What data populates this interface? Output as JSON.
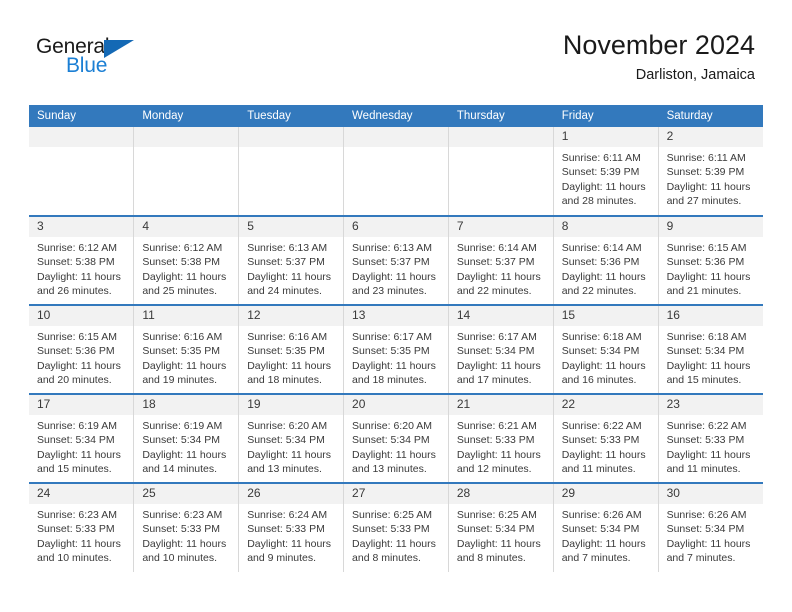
{
  "brand": {
    "name_part1": "General",
    "name_part2": "Blue",
    "accent_color": "#1b7fd4",
    "triangle_color": "#1469b5"
  },
  "header": {
    "title": "November 2024",
    "subtitle": "Darliston, Jamaica",
    "header_bar_color": "#3379bd"
  },
  "weekdays": [
    "Sunday",
    "Monday",
    "Tuesday",
    "Wednesday",
    "Thursday",
    "Friday",
    "Saturday"
  ],
  "weeks": [
    [
      {
        "day": "",
        "blank": true
      },
      {
        "day": "",
        "blank": true
      },
      {
        "day": "",
        "blank": true
      },
      {
        "day": "",
        "blank": true
      },
      {
        "day": "",
        "blank": true
      },
      {
        "day": "1",
        "sunrise": "Sunrise: 6:11 AM",
        "sunset": "Sunset: 5:39 PM",
        "daylight": "Daylight: 11 hours and 28 minutes."
      },
      {
        "day": "2",
        "sunrise": "Sunrise: 6:11 AM",
        "sunset": "Sunset: 5:39 PM",
        "daylight": "Daylight: 11 hours and 27 minutes."
      }
    ],
    [
      {
        "day": "3",
        "sunrise": "Sunrise: 6:12 AM",
        "sunset": "Sunset: 5:38 PM",
        "daylight": "Daylight: 11 hours and 26 minutes."
      },
      {
        "day": "4",
        "sunrise": "Sunrise: 6:12 AM",
        "sunset": "Sunset: 5:38 PM",
        "daylight": "Daylight: 11 hours and 25 minutes."
      },
      {
        "day": "5",
        "sunrise": "Sunrise: 6:13 AM",
        "sunset": "Sunset: 5:37 PM",
        "daylight": "Daylight: 11 hours and 24 minutes."
      },
      {
        "day": "6",
        "sunrise": "Sunrise: 6:13 AM",
        "sunset": "Sunset: 5:37 PM",
        "daylight": "Daylight: 11 hours and 23 minutes."
      },
      {
        "day": "7",
        "sunrise": "Sunrise: 6:14 AM",
        "sunset": "Sunset: 5:37 PM",
        "daylight": "Daylight: 11 hours and 22 minutes."
      },
      {
        "day": "8",
        "sunrise": "Sunrise: 6:14 AM",
        "sunset": "Sunset: 5:36 PM",
        "daylight": "Daylight: 11 hours and 22 minutes."
      },
      {
        "day": "9",
        "sunrise": "Sunrise: 6:15 AM",
        "sunset": "Sunset: 5:36 PM",
        "daylight": "Daylight: 11 hours and 21 minutes."
      }
    ],
    [
      {
        "day": "10",
        "sunrise": "Sunrise: 6:15 AM",
        "sunset": "Sunset: 5:36 PM",
        "daylight": "Daylight: 11 hours and 20 minutes."
      },
      {
        "day": "11",
        "sunrise": "Sunrise: 6:16 AM",
        "sunset": "Sunset: 5:35 PM",
        "daylight": "Daylight: 11 hours and 19 minutes."
      },
      {
        "day": "12",
        "sunrise": "Sunrise: 6:16 AM",
        "sunset": "Sunset: 5:35 PM",
        "daylight": "Daylight: 11 hours and 18 minutes."
      },
      {
        "day": "13",
        "sunrise": "Sunrise: 6:17 AM",
        "sunset": "Sunset: 5:35 PM",
        "daylight": "Daylight: 11 hours and 18 minutes."
      },
      {
        "day": "14",
        "sunrise": "Sunrise: 6:17 AM",
        "sunset": "Sunset: 5:34 PM",
        "daylight": "Daylight: 11 hours and 17 minutes."
      },
      {
        "day": "15",
        "sunrise": "Sunrise: 6:18 AM",
        "sunset": "Sunset: 5:34 PM",
        "daylight": "Daylight: 11 hours and 16 minutes."
      },
      {
        "day": "16",
        "sunrise": "Sunrise: 6:18 AM",
        "sunset": "Sunset: 5:34 PM",
        "daylight": "Daylight: 11 hours and 15 minutes."
      }
    ],
    [
      {
        "day": "17",
        "sunrise": "Sunrise: 6:19 AM",
        "sunset": "Sunset: 5:34 PM",
        "daylight": "Daylight: 11 hours and 15 minutes."
      },
      {
        "day": "18",
        "sunrise": "Sunrise: 6:19 AM",
        "sunset": "Sunset: 5:34 PM",
        "daylight": "Daylight: 11 hours and 14 minutes."
      },
      {
        "day": "19",
        "sunrise": "Sunrise: 6:20 AM",
        "sunset": "Sunset: 5:34 PM",
        "daylight": "Daylight: 11 hours and 13 minutes."
      },
      {
        "day": "20",
        "sunrise": "Sunrise: 6:20 AM",
        "sunset": "Sunset: 5:34 PM",
        "daylight": "Daylight: 11 hours and 13 minutes."
      },
      {
        "day": "21",
        "sunrise": "Sunrise: 6:21 AM",
        "sunset": "Sunset: 5:33 PM",
        "daylight": "Daylight: 11 hours and 12 minutes."
      },
      {
        "day": "22",
        "sunrise": "Sunrise: 6:22 AM",
        "sunset": "Sunset: 5:33 PM",
        "daylight": "Daylight: 11 hours and 11 minutes."
      },
      {
        "day": "23",
        "sunrise": "Sunrise: 6:22 AM",
        "sunset": "Sunset: 5:33 PM",
        "daylight": "Daylight: 11 hours and 11 minutes."
      }
    ],
    [
      {
        "day": "24",
        "sunrise": "Sunrise: 6:23 AM",
        "sunset": "Sunset: 5:33 PM",
        "daylight": "Daylight: 11 hours and 10 minutes."
      },
      {
        "day": "25",
        "sunrise": "Sunrise: 6:23 AM",
        "sunset": "Sunset: 5:33 PM",
        "daylight": "Daylight: 11 hours and 10 minutes."
      },
      {
        "day": "26",
        "sunrise": "Sunrise: 6:24 AM",
        "sunset": "Sunset: 5:33 PM",
        "daylight": "Daylight: 11 hours and 9 minutes."
      },
      {
        "day": "27",
        "sunrise": "Sunrise: 6:25 AM",
        "sunset": "Sunset: 5:33 PM",
        "daylight": "Daylight: 11 hours and 8 minutes."
      },
      {
        "day": "28",
        "sunrise": "Sunrise: 6:25 AM",
        "sunset": "Sunset: 5:34 PM",
        "daylight": "Daylight: 11 hours and 8 minutes."
      },
      {
        "day": "29",
        "sunrise": "Sunrise: 6:26 AM",
        "sunset": "Sunset: 5:34 PM",
        "daylight": "Daylight: 11 hours and 7 minutes."
      },
      {
        "day": "30",
        "sunrise": "Sunrise: 6:26 AM",
        "sunset": "Sunset: 5:34 PM",
        "daylight": "Daylight: 11 hours and 7 minutes."
      }
    ]
  ]
}
